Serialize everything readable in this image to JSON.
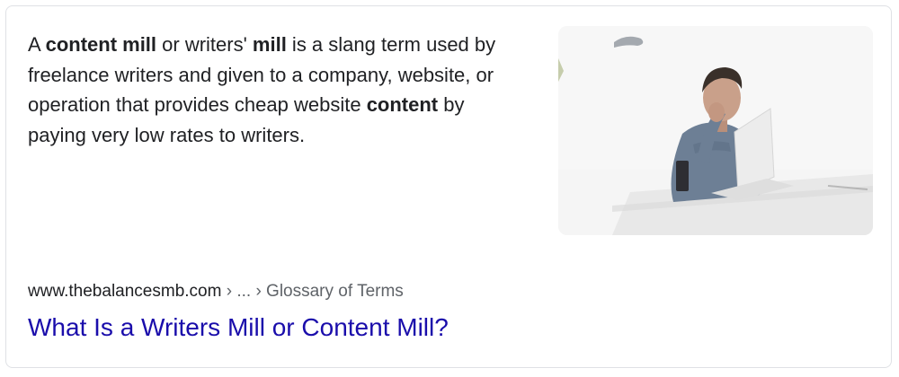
{
  "snippet": {
    "w1": "A ",
    "b1": "content mill",
    "w2": " or writers' ",
    "b2": "mill",
    "w3": " is a slang term used by freelance writers and given to a company, website, or operation that provides cheap website ",
    "b3": "content",
    "w4": " by paying very low rates to writers."
  },
  "result": {
    "domain": "www.thebalancesmb.com",
    "breadcrumb": " › ... › Glossary of Terms",
    "title": "What Is a Writers Mill or Content Mill?"
  },
  "thumbnail": {
    "icon": "person-at-laptop-photo",
    "colors": {
      "background": "#f3f3f3",
      "shirt": "#6d7f95",
      "hair": "#3a302a",
      "skin": "#c9a08a",
      "laptop": "#ececec"
    }
  },
  "colors": {
    "text": "#202124",
    "breadcrumb": "#5f6368",
    "link": "#1a0dab",
    "border": "#dfe1e5"
  }
}
